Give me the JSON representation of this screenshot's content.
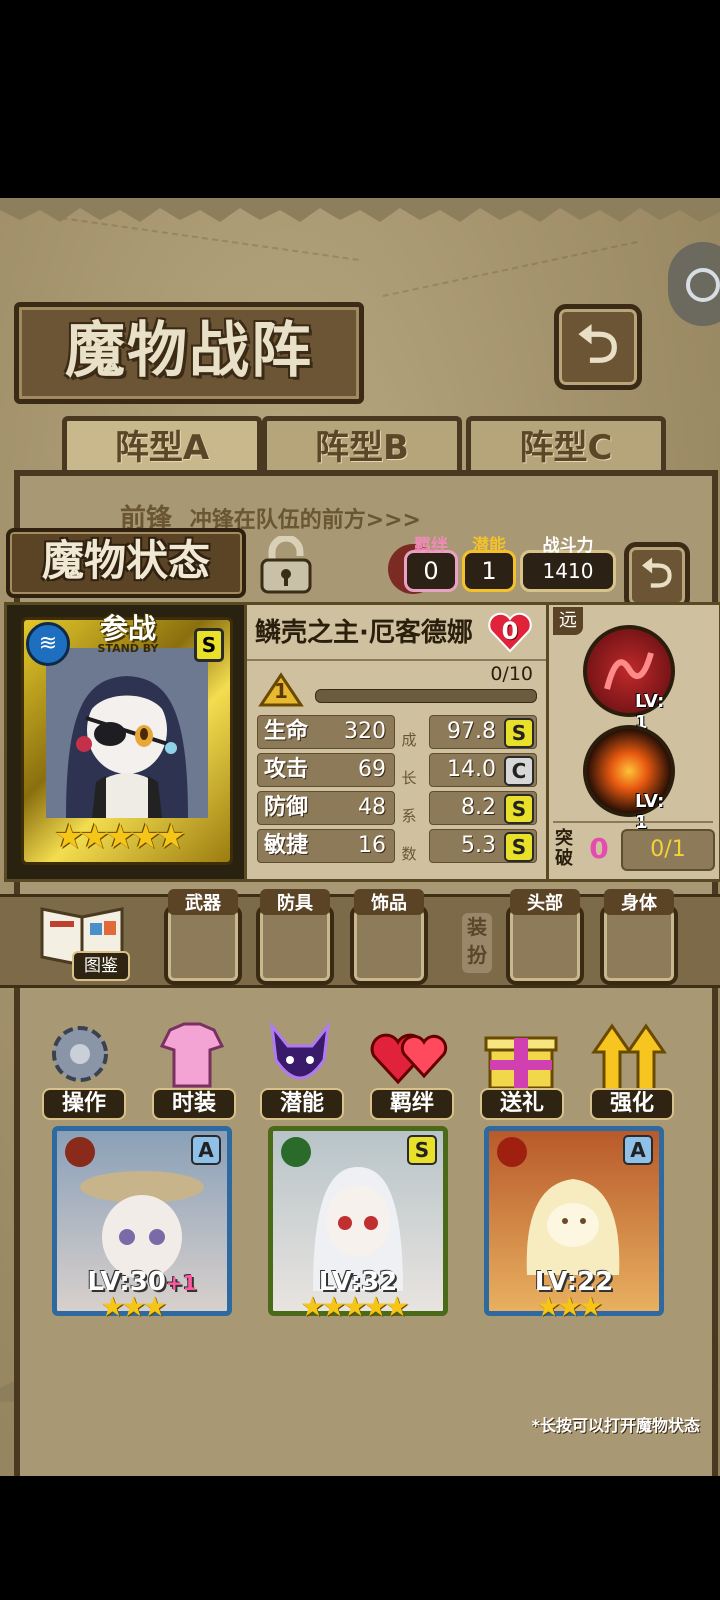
{
  "screen": {
    "title": "魔物战阵",
    "tabs": [
      {
        "label": "阵型A",
        "active": true
      },
      {
        "label": "阵型B",
        "active": false
      },
      {
        "label": "阵型C",
        "active": false
      }
    ],
    "frontline_label": "前锋",
    "frontline_desc": "冲锋在队伍的前方>>>",
    "status_title": "魔物状态",
    "bond": {
      "label": "羁绊",
      "value": "0"
    },
    "potential": {
      "label": "潜能",
      "value": "1"
    },
    "power": {
      "label": "战斗力",
      "value": "1410"
    }
  },
  "monster": {
    "name": "鳞壳之主·厄客德娜",
    "heart_count": "0",
    "standby_label": "参战",
    "standby_sub": "STAND BY",
    "rarity_badge": "S",
    "star_count": 5,
    "level": "1",
    "exp": "0/10",
    "exp_fraction": 0.0,
    "growth_label": "成长系数",
    "stats": [
      {
        "name": "生命",
        "value": "320",
        "growth": "97.8",
        "grade": "S"
      },
      {
        "name": "攻击",
        "value": "69",
        "growth": "14.0",
        "grade": "C"
      },
      {
        "name": "防御",
        "value": "48",
        "growth": "8.2",
        "grade": "S"
      },
      {
        "name": "敏捷",
        "value": "16",
        "growth": "5.3",
        "grade": "S"
      }
    ],
    "range_label": "远",
    "skills": [
      {
        "name": "serpent-skill-icon",
        "level": "LV: 1"
      },
      {
        "name": "burst-skill-icon",
        "level": "LV: 1"
      }
    ],
    "breakthrough_label": "突破",
    "breakthrough_count": "0",
    "breakthrough_progress": "0/1"
  },
  "equipment": {
    "codex_label": "图鉴",
    "dress_label": "装扮",
    "slots": [
      {
        "label": "武器"
      },
      {
        "label": "防具"
      },
      {
        "label": "饰品"
      },
      {
        "label": "头部"
      },
      {
        "label": "身体"
      }
    ]
  },
  "menu": [
    {
      "label": "操作",
      "icon": "gear-icon"
    },
    {
      "label": "时装",
      "icon": "outfit-icon"
    },
    {
      "label": "潜能",
      "icon": "demon-icon"
    },
    {
      "label": "羁绊",
      "icon": "hearts-icon"
    },
    {
      "label": "送礼",
      "icon": "gift-icon"
    },
    {
      "label": "强化",
      "icon": "upgrade-arrows-icon"
    }
  ],
  "team": [
    {
      "level": "LV:30",
      "bonus": "+1",
      "grade": "A",
      "stars": 3,
      "element": "earth"
    },
    {
      "level": "LV:32",
      "bonus": "",
      "grade": "S",
      "stars": 5,
      "element": "nature"
    },
    {
      "level": "LV:22",
      "bonus": "",
      "grade": "A",
      "stars": 3,
      "element": "fire"
    }
  ],
  "hint": "*长按可以打开魔物状态",
  "colors": {
    "gold": "#f5c518",
    "panel": "#a89873",
    "dark_brown": "#3b2a16",
    "grade_s": "#e9e02a",
    "grade_c": "#d7d7d7"
  }
}
